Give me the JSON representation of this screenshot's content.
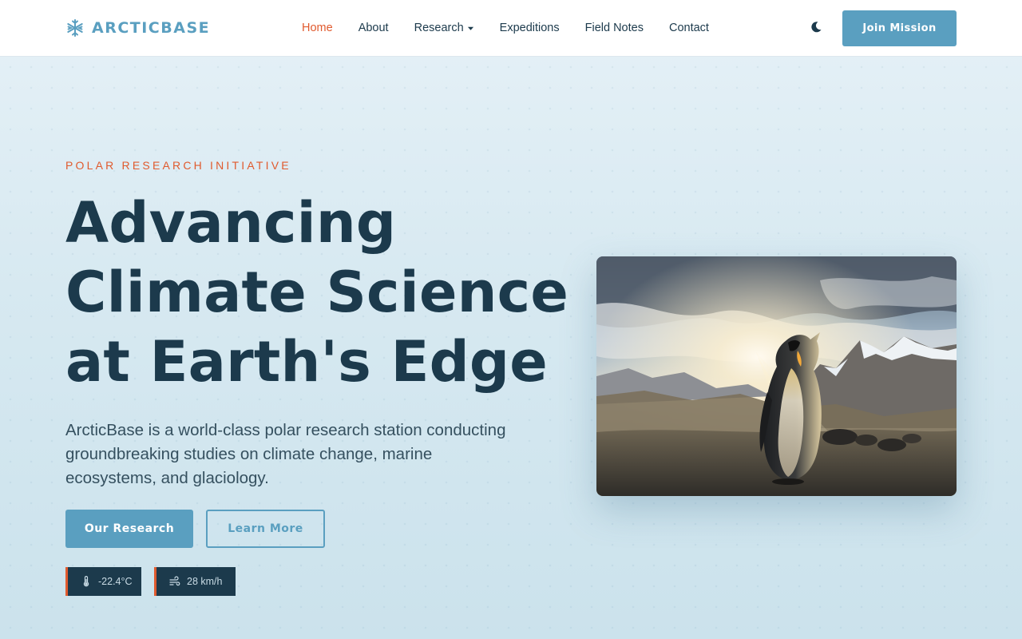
{
  "brand": {
    "name": "ARCTICBASE",
    "icon": "snowflake-icon",
    "color": "#5a9fc0"
  },
  "nav": {
    "items": [
      {
        "label": "Home",
        "active": true
      },
      {
        "label": "About"
      },
      {
        "label": "Research",
        "dropdown": true
      },
      {
        "label": "Expeditions"
      },
      {
        "label": "Field Notes"
      },
      {
        "label": "Contact"
      }
    ],
    "theme_toggle_icon": "moon-icon",
    "join_label": "Join Mission"
  },
  "hero": {
    "eyebrow": "POLAR RESEARCH INITIATIVE",
    "title": "Advancing Climate Science at Earth's Edge",
    "description": "ArcticBase is a world-class polar research station conducting groundbreaking studies on climate change, marine ecosystems, and glaciology.",
    "primary_cta": "Our Research",
    "secondary_cta": "Learn More",
    "stats": [
      {
        "icon": "thermometer-icon",
        "value": "-22.4°C"
      },
      {
        "icon": "wind-icon",
        "value": "28 km/h"
      }
    ],
    "image_subject": "king penguin on rocky beach with snowy mountains and sunburst"
  },
  "colors": {
    "accent": "#5a9fc0",
    "highlight": "#e05a2e",
    "text_dark": "#1c3a4c"
  }
}
